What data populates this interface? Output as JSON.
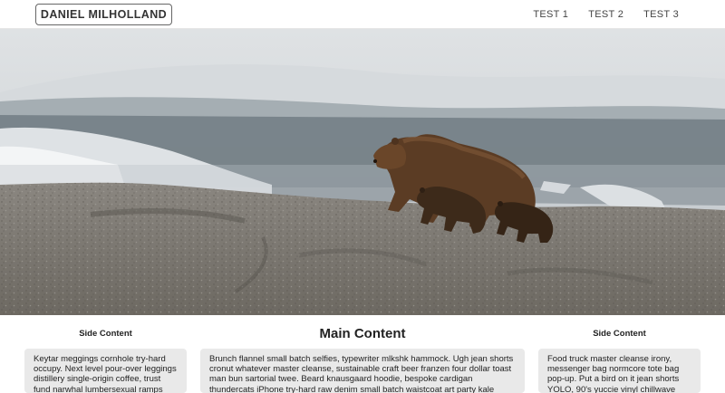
{
  "header": {
    "brand": "DANIEL MILHOLLAND",
    "nav": [
      {
        "label": "TEST 1"
      },
      {
        "label": "TEST 2"
      },
      {
        "label": "TEST 3"
      }
    ]
  },
  "hero": {
    "image": "grizzly-bear-with-cubs-on-rocky-hillside"
  },
  "left_column": {
    "title": "Side Content",
    "text": "Keytar meggings cornhole try-hard occupy. Next level pour-over leggings distillery single-origin coffee, trust fund narwhal lumbersexual ramps cold-pressed"
  },
  "main_column": {
    "title": "Main Content",
    "text": "Brunch flannel small batch selfies, typewriter mlkshk hammock. Ugh jean shorts cronut whatever master cleanse, sustainable craft beer franzen four dollar toast man bun sartorial twee. Beard knausgaard hoodie, bespoke cardigan thundercats iPhone try-hard raw denim small batch waistcoat art party kale chips. Cold-pressed post-ironic vinyl"
  },
  "right_column": {
    "title": "Side Content",
    "text": "Food truck master cleanse irony, messenger bag normcore tote bag pop-up. Put a bird on it jean shorts YOLO, 90's yuccie vinyl chillwave salvia williamsburg"
  }
}
